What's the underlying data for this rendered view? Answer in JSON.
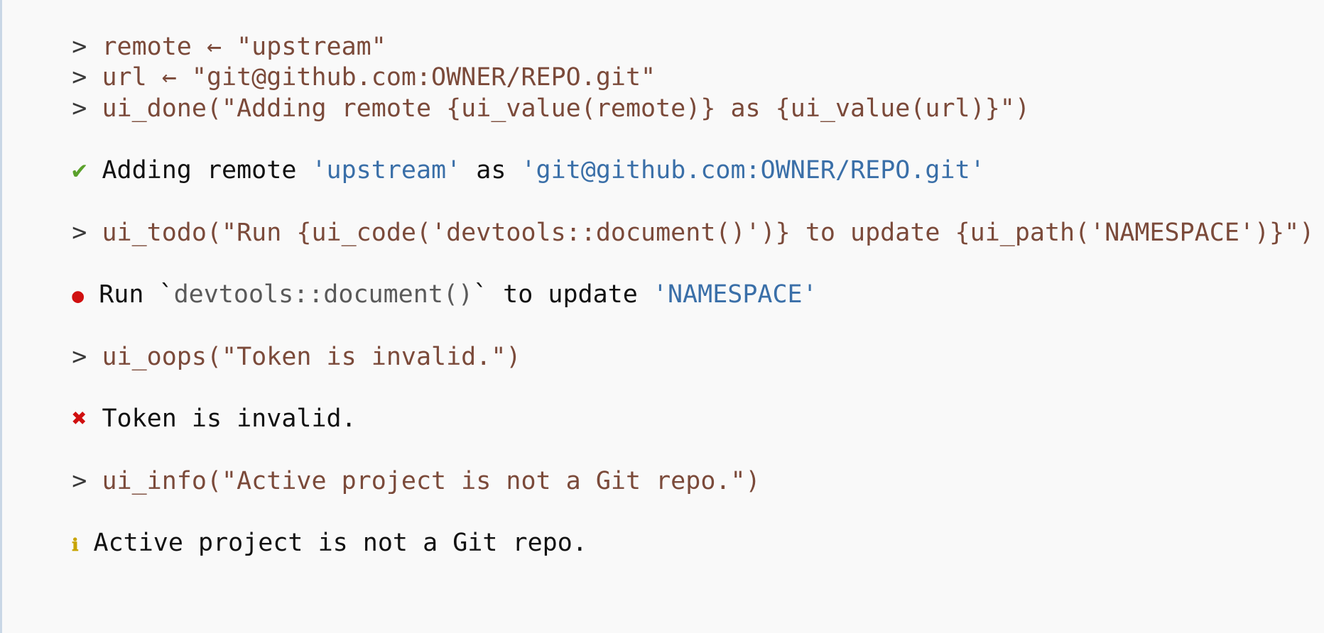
{
  "console": {
    "prompt": ">",
    "cmd1": "remote ← \"upstream\"",
    "cmd2": "url ← \"git@github.com:OWNER/REPO.git\"",
    "cmd3": "ui_done(\"Adding remote {ui_value(remote)} as {ui_value(url)}\")",
    "done": {
      "icon": "✔",
      "text_a": "Adding remote ",
      "value_a": "'upstream'",
      "text_b": " as ",
      "value_b": "'git@github.com:OWNER/REPO.git'"
    },
    "cmd4": "ui_todo(\"Run {ui_code('devtools::document()')} to update {ui_path('NAMESPACE')}\")",
    "todo": {
      "icon": "●",
      "text_a": "Run `",
      "code": "devtools::document()",
      "text_b": "` to update ",
      "path": "'NAMESPACE'"
    },
    "cmd5": "ui_oops(\"Token is invalid.\")",
    "oops": {
      "icon": "✖",
      "text": "Token is invalid."
    },
    "cmd6": "ui_info(\"Active project is not a Git repo.\")",
    "info": {
      "icon": "ℹ",
      "text": "Active project is not a Git repo."
    }
  },
  "colors": {
    "command": "#7b4a3a",
    "value": "#3a6fa8",
    "ok": "#5aa12b",
    "error": "#d01010",
    "info": "#c8a400"
  }
}
